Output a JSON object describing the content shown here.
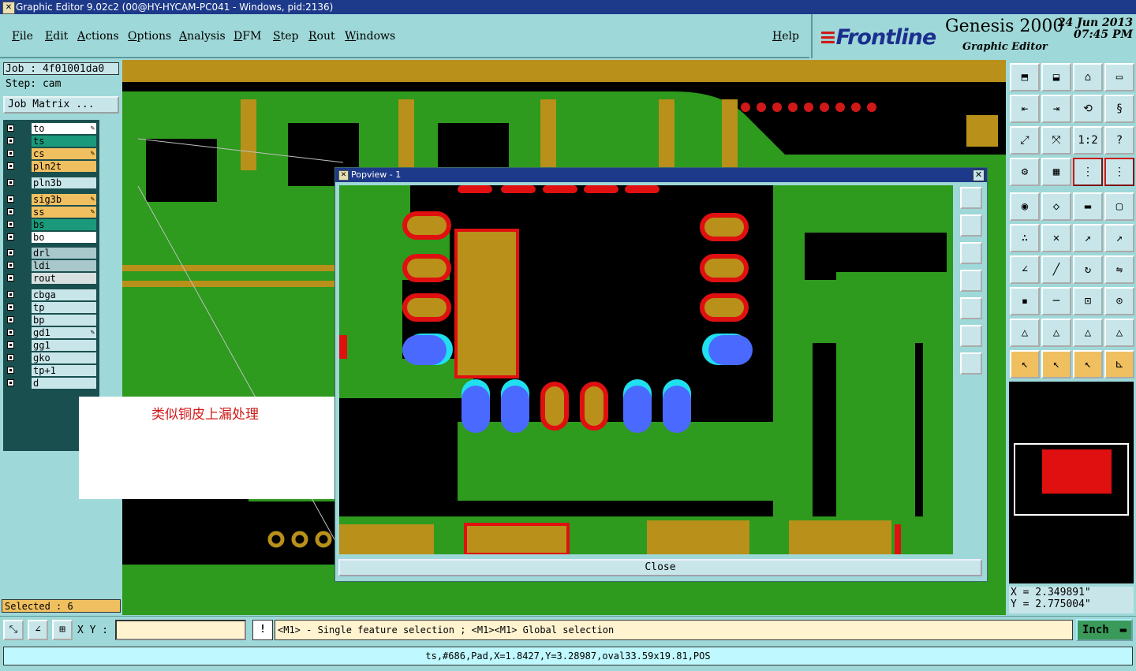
{
  "window": {
    "title": "Graphic Editor 9.02c2 (00@HY-HYCAM-PC041 - Windows, pid:2136)"
  },
  "menu": [
    "File",
    "Edit",
    "Actions",
    "Options",
    "Analysis",
    "DFM",
    "Step",
    "Rout",
    "Windows",
    "Help"
  ],
  "brand": {
    "logo": "Frontline",
    "product": "Genesis 2000",
    "subtitle": "Graphic Editor",
    "date": "24 Jun 2013",
    "time": "07:45 PM"
  },
  "job": {
    "job_label": "Job : 4f01001da0",
    "step_label": "Step: cam",
    "matrix_button": "Job Matrix ..."
  },
  "layers": [
    {
      "name": "to",
      "color": "#ffffff",
      "edit": true
    },
    {
      "name": "ts",
      "color": "#1a9a7a",
      "edit": false,
      "active": true
    },
    {
      "name": "cs",
      "color": "#f0c060",
      "edit": true
    },
    {
      "name": "pln2t",
      "color": "#f0c060",
      "edit": false
    },
    {
      "name": "pln3b",
      "color": "#c8e6ea",
      "edit": false
    },
    {
      "name": "sig3b",
      "color": "#f0c060",
      "edit": true
    },
    {
      "name": "ss",
      "color": "#f0c060",
      "edit": true
    },
    {
      "name": "bs",
      "color": "#1a9a7a",
      "edit": false
    },
    {
      "name": "bo",
      "color": "#ffffff",
      "edit": false
    },
    {
      "name": "drl",
      "color": "#a8c8cc",
      "edit": false
    },
    {
      "name": "ldi",
      "color": "#a8c8cc",
      "edit": false
    },
    {
      "name": "rout",
      "color": "#d8e0e0",
      "edit": false
    },
    {
      "name": "cbga",
      "color": "#c8e6ea",
      "edit": false
    },
    {
      "name": "tp",
      "color": "#c8e6ea",
      "edit": false
    },
    {
      "name": "bp",
      "color": "#c8e6ea",
      "edit": false
    },
    {
      "name": "gd1",
      "color": "#c8e6ea",
      "edit": true
    },
    {
      "name": "gg1",
      "color": "#c8e6ea",
      "edit": false
    },
    {
      "name": "gko",
      "color": "#c8e6ea",
      "edit": false
    },
    {
      "name": "tp+1",
      "color": "#c8e6ea",
      "edit": false
    },
    {
      "name": "d",
      "color": "#c8e6ea",
      "edit": false
    }
  ],
  "selected": "Selected : 6",
  "annotation": "类似铜皮上漏处理",
  "popview": {
    "title": "Popview - 1",
    "close_label": "Close"
  },
  "coords": {
    "x": "X = 2.349891\"",
    "y": "Y = 2.775004\""
  },
  "bottom": {
    "xy_label": "X Y :",
    "hint": "<M1> - Single feature selection ; <M1><M1> Global selection",
    "units": "Inch"
  },
  "status": "ts,#686,Pad,X=1.8427,Y=3.28987,oval33.59x19.81,POS",
  "colors": {
    "copper": "#b8901a",
    "green": "#2e9a1e",
    "red": "#e01010",
    "blue": "#4a6aff",
    "cyan": "#20e0f0"
  }
}
